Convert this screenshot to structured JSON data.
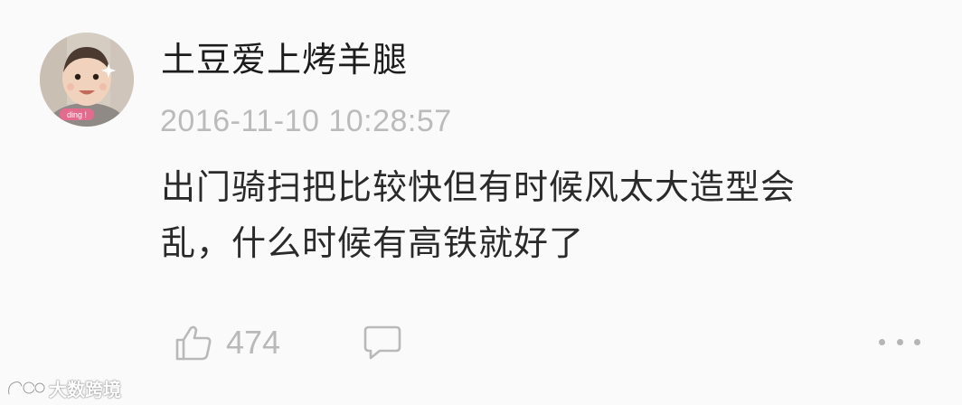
{
  "comment": {
    "username": "土豆爱上烤羊腿",
    "timestamp": "2016-11-10 10:28:57",
    "body_lines": [
      "出门骑扫把比较快但有时候风太大造型会",
      "乱，什么时候有高铁就好了"
    ],
    "avatar": {
      "icon": "baby-photo-avatar",
      "sticker_text": "ding !"
    }
  },
  "actions": {
    "like_icon": "thumbs-up-icon",
    "like_count": "474",
    "reply_icon": "speech-bubble-icon",
    "more_icon": "more-dots-icon"
  },
  "watermark": {
    "text": "大数跨境"
  },
  "colors": {
    "background": "#fafafa",
    "username": "#1c1c1c",
    "body_text": "#2a2a2a",
    "meta_gray": "#bbbbbb"
  }
}
